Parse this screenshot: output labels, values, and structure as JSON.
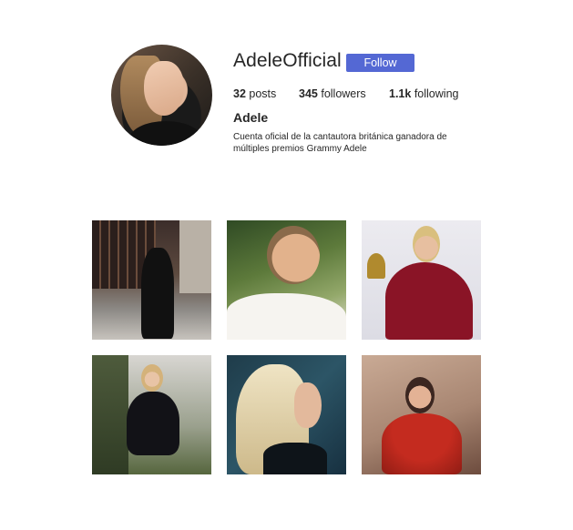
{
  "profile": {
    "username": "AdeleOfficial",
    "follow_label": "Follow",
    "display_name": "Adele",
    "bio": "Cuenta oficial de la cantautora británica ganadora de múltiples premios Grammy Adele",
    "avatar_icon": "avatar-photo"
  },
  "stats": {
    "posts": {
      "count": "32",
      "label": "posts"
    },
    "followers": {
      "count": "345",
      "label": "followers"
    },
    "following": {
      "count": "1.1k",
      "label": "following"
    }
  },
  "colors": {
    "accent": "#5468d4",
    "text": "#262626",
    "background": "#ffffff"
  },
  "posts": [
    {
      "name": "post-stage-black-gown"
    },
    {
      "name": "post-portrait-white-dress"
    },
    {
      "name": "post-grammy-red-dress"
    },
    {
      "name": "post-black-dress-garden"
    },
    {
      "name": "post-profile-blonde-hair"
    },
    {
      "name": "post-red-dress-portrait"
    }
  ]
}
